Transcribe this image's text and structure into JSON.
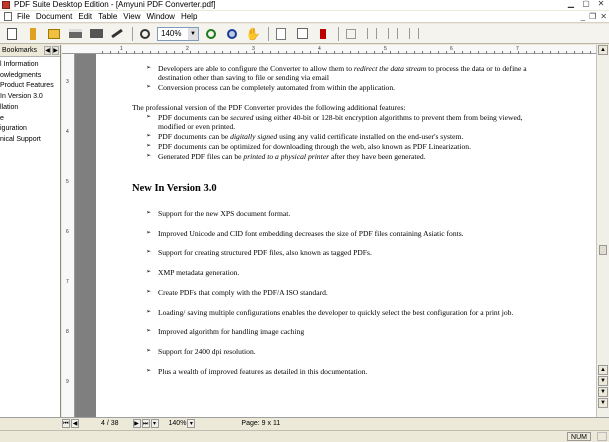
{
  "window": {
    "title": "PDF Suite Desktop Edition - [Amyuni PDF Converter.pdf]"
  },
  "menu": {
    "items": [
      "File",
      "Document",
      "Edit",
      "Table",
      "View",
      "Window",
      "Help"
    ]
  },
  "toolbar": {
    "zoom_value": "140%"
  },
  "bookmarks": {
    "title": "Bookmarks",
    "items": [
      "l Information",
      "owledgments",
      "Product Features",
      "In Version 3.0",
      "llation",
      "e",
      "iguration",
      "nical Support"
    ]
  },
  "document": {
    "top_lines": [
      {
        "text_before": "Developers are able to configure the Converter to allow them to ",
        "italic": "redirect the data stream",
        "text_after": " to process the data or to define a",
        "cont": "destination other than saving to file or sending via email"
      },
      {
        "text_before": "Conversion process can be completely automated from within the application.",
        "italic": "",
        "text_after": "",
        "cont": ""
      }
    ],
    "pro_intro": "The professional version of the PDF Converter provides the following additional features:",
    "pro_items": [
      {
        "a": "PDF documents can be ",
        "i": "secured",
        "b": " using either 40-bit or 128-bit encryption algorithms to prevent them from being viewed,",
        "cont": "modified or even printed."
      },
      {
        "a": "PDF documents can be ",
        "i": "digitally signed",
        "b": " using any valid certificate installed on the end-user's system.",
        "cont": ""
      },
      {
        "a": "PDF documents can be optimized for downloading through the web, also known as PDF Linearization.",
        "i": "",
        "b": "",
        "cont": ""
      },
      {
        "a": "Generated PDF files can be ",
        "i": "printed to a physical printer",
        "b": " after they have been generated.",
        "cont": ""
      }
    ],
    "heading": "New In Version 3.0",
    "new_items": [
      "Support for the new XPS document format.",
      "Improved Unicode and CID font embedding decreases the size of PDF files containing Asiatic fonts.",
      "Support for creating structured PDF files, also known as tagged PDFs.",
      "XMP metadata generation.",
      "Create PDFs that comply with the PDF/A ISO standard.",
      "Loading/ saving multiple configurations enables the developer to quickly select the best configuration for a print job.",
      "Improved algorithm for handling image caching",
      "Support for 2400 dpi resolution.",
      "Plus a wealth of improved features as detailed in this documentation."
    ]
  },
  "navbar": {
    "page": "4 / 38",
    "zoom": "140%",
    "page_size": "Page: 9 x 11"
  },
  "status": {
    "num": "NUM"
  },
  "ruler": {
    "top_numbers": [
      "1",
      "2",
      "3",
      "4",
      "5",
      "6",
      "7"
    ],
    "left_numbers": [
      "3",
      "4",
      "5",
      "6",
      "7",
      "8",
      "9"
    ]
  }
}
